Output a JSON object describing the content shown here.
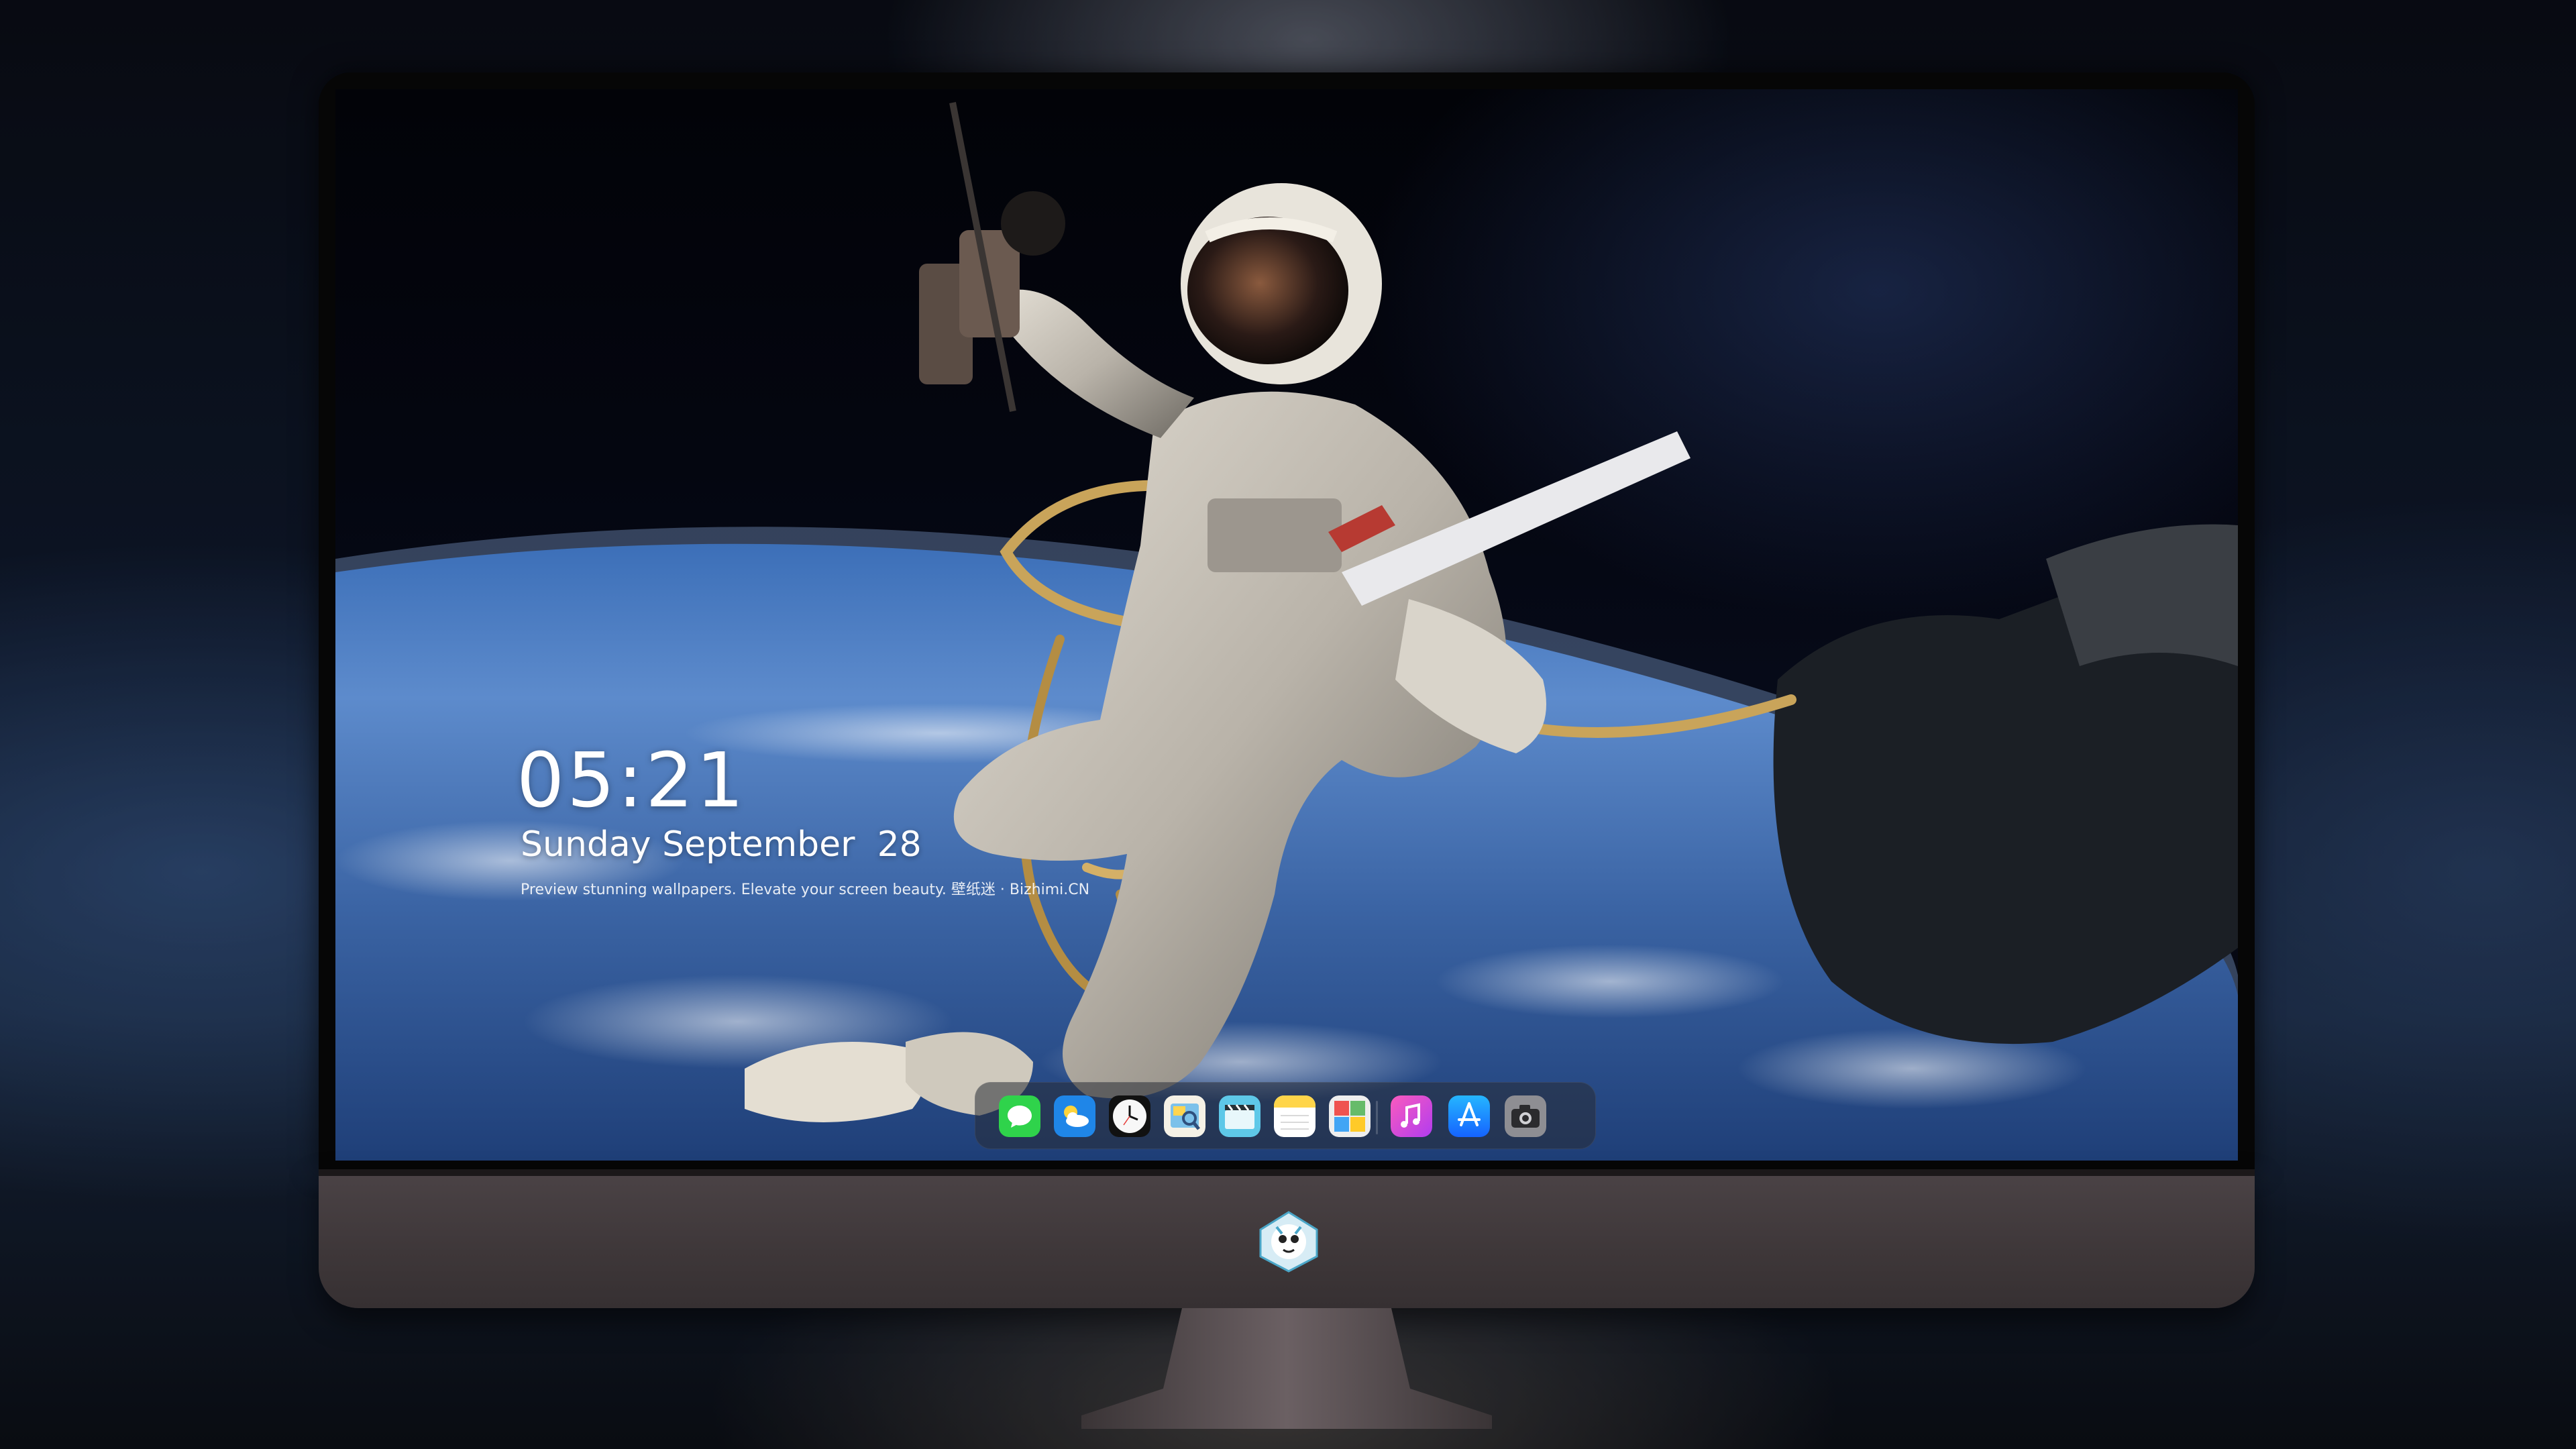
{
  "lock_screen": {
    "time": "05:21",
    "date": "Sunday September  28",
    "tagline": "Preview stunning wallpapers. Elevate your screen beauty. 壁纸迷 · Bizhimi.CN"
  },
  "dock": {
    "apps": [
      {
        "icon": "messages-icon"
      },
      {
        "icon": "weather-icon"
      },
      {
        "icon": "clock-icon"
      },
      {
        "icon": "preview-icon"
      },
      {
        "icon": "clips-icon"
      },
      {
        "icon": "notes-icon"
      },
      {
        "icon": "photo-booth-icon"
      },
      {
        "icon": "music-icon"
      },
      {
        "icon": "app-store-icon"
      },
      {
        "icon": "camera-icon"
      }
    ]
  },
  "colors": {
    "clock_text": "#ffffff",
    "monitor_chin": "#433c3e",
    "bezel": "#060606"
  }
}
